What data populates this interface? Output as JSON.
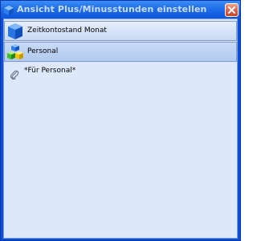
{
  "window": {
    "title": "Ansicht Plus/Minusstunden einstellen"
  },
  "list": {
    "groups": [
      {
        "label": "Zeitkontostand Monat",
        "icon": "blue-cube-icon",
        "selected": false
      },
      {
        "label": "Personal",
        "icon": "colored-cubes-icon",
        "selected": true
      }
    ],
    "items": [
      {
        "label": "*Für Personal*",
        "icon": "paperclip-icon"
      }
    ]
  },
  "colors": {
    "titlebar": "#1f6ee8",
    "client_bg": "#dde9fb",
    "row_border": "#7f9bd1",
    "close_button": "#dd5f46"
  }
}
